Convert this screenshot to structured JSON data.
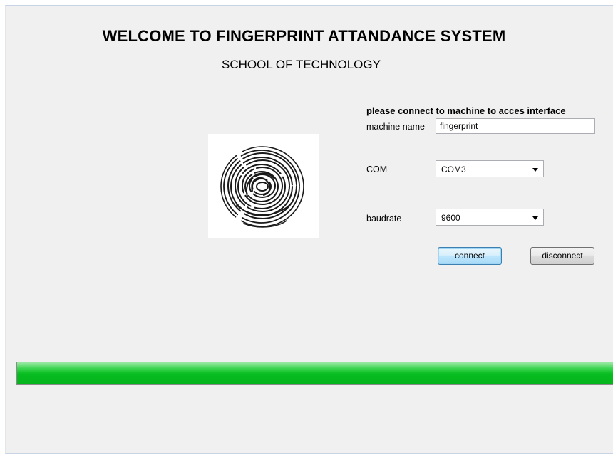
{
  "header": {
    "title": "WELCOME TO FINGERPRINT ATTANDANCE SYSTEM",
    "subtitle": "SCHOOL OF TECHNOLOGY"
  },
  "connection": {
    "prompt": "please connect to machine to acces interface",
    "machine_name_label": "machine name",
    "machine_name_value": "fingerprint",
    "com_label": "COM",
    "com_value": "COM3",
    "baudrate_label": "baudrate",
    "baudrate_value": "9600",
    "connect_label": "connect",
    "disconnect_label": "disconnect"
  },
  "progress": {
    "percent": 100,
    "color": "#06bc1f"
  },
  "icons": {
    "fingerprint": "fingerprint-image"
  }
}
